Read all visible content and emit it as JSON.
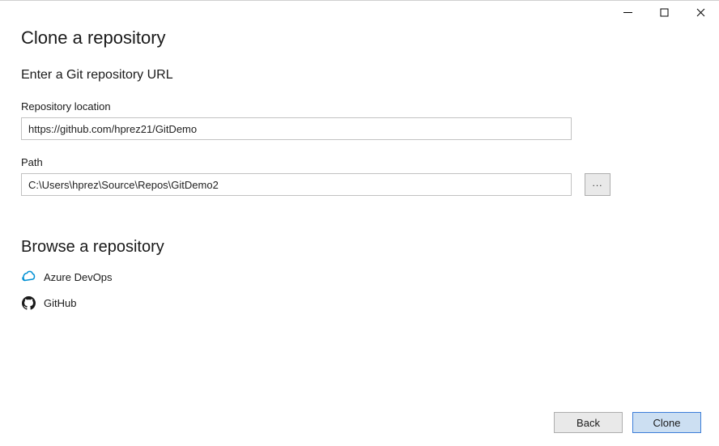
{
  "window": {
    "title": "Clone a repository"
  },
  "sections": {
    "enter_url": {
      "heading": "Enter a Git repository URL"
    },
    "browse": {
      "heading": "Browse a repository",
      "options": {
        "azure_devops": "Azure DevOps",
        "github": "GitHub"
      }
    }
  },
  "fields": {
    "repo_location": {
      "label": "Repository location",
      "value": "https://github.com/hprez21/GitDemo"
    },
    "path": {
      "label": "Path",
      "value": "C:\\Users\\hprez\\Source\\Repos\\GitDemo2",
      "browse_label": "..."
    }
  },
  "footer": {
    "back": "Back",
    "clone": "Clone"
  }
}
